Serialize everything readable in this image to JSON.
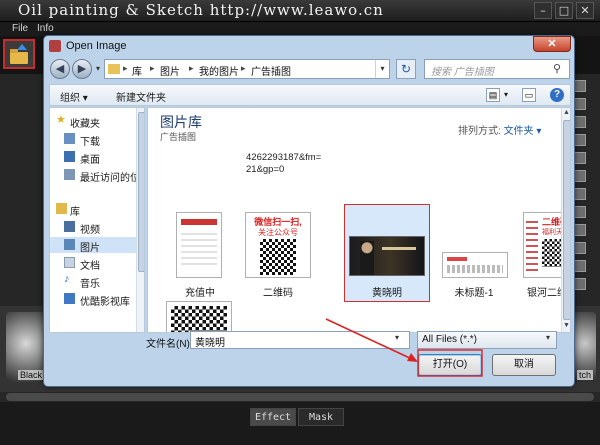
{
  "app": {
    "title": "Oil painting & Sketch  http://www.leawo.cn",
    "minimize": "–",
    "maximize": "□",
    "close": "✕",
    "menu": [
      "File",
      "Info"
    ],
    "left_thumb_caption": "Black",
    "right_thumb_caption": "tch",
    "tabs": [
      "Effect",
      "Mask"
    ]
  },
  "dialog": {
    "title": "Open Image",
    "close": "✕",
    "breadcrumbs": [
      "库",
      "图片",
      "我的图片",
      "广告插图"
    ],
    "search_placeholder": "搜索 广告插图",
    "toolbar": {
      "organize": "组织 ▾",
      "new_folder": "新建文件夹"
    },
    "nav": {
      "favorites": "收藏夹",
      "favorites_items": [
        "下载",
        "桌面",
        "最近访问的位"
      ],
      "libraries": "库",
      "library_items": [
        "视频",
        "图片",
        "文档",
        "音乐",
        "优酷影视库"
      ]
    },
    "library_title": "图片库",
    "library_subtitle": "广告插图",
    "arrange_label": "排列方式:",
    "arrange_value": "文件夹 ▾",
    "top_item_text": "4262293187&fm=21&gp=0",
    "files": [
      {
        "name": "充值中"
      },
      {
        "name": "二维码"
      },
      {
        "name": "黄晓明"
      },
      {
        "name": "未标题-1"
      },
      {
        "name": "银河二维码"
      }
    ],
    "thumb_texts": {
      "qr_banner_top": "微信扫一扫,",
      "qr_banner_bottom": "关注公众号",
      "poster_top": "二维码",
      "poster_line": "福利天天送"
    },
    "filename_label": "文件名(N):",
    "filename_value": "黄晓明",
    "filter_value": "All Files (*.*)",
    "open_button": "打开(O)",
    "cancel_button": "取消"
  }
}
